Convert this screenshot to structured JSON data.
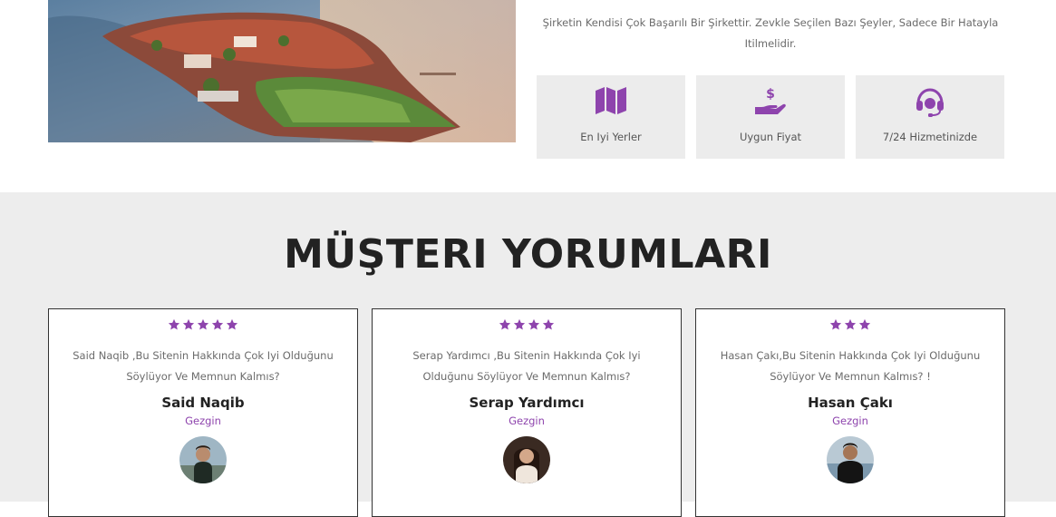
{
  "about": {
    "text": "Şirketin Kendisi Çok Başarılı Bir Şirkettir. Zevkle Seçilen Bazı Şeyler, Sadece Bir Hatayla Itilmelidir."
  },
  "features": [
    {
      "label": "En Iyi Yerler",
      "icon": "map-icon"
    },
    {
      "label": "Uygun Fiyat",
      "icon": "hand-dollar-icon"
    },
    {
      "label": "7/24 Hizmetinizde",
      "icon": "headset-icon"
    }
  ],
  "reviews": {
    "title": "MÜŞTERI YORUMLARI",
    "items": [
      {
        "rating": 5,
        "quote": "Said Naqib ,Bu Sitenin Hakkında Çok Iyi Olduğunu Söylüyor Ve Memnun Kalmıs?",
        "name": "Said Naqib",
        "role": "Gezgin"
      },
      {
        "rating": 4,
        "quote": "Serap Yardımcı ,Bu Sitenin Hakkında Çok Iyi Olduğunu Söylüyor Ve Memnun Kalmıs?",
        "name": "Serap Yardımcı",
        "role": "Gezgin"
      },
      {
        "rating": 3,
        "quote": "Hasan Çakı,Bu Sitenin Hakkında Çok Iyi Olduğunu Söylüyor Ve Memnun Kalmıs? !",
        "name": "Hasan Çakı",
        "role": "Gezgin"
      }
    ]
  },
  "colors": {
    "accent": "#8e44ad",
    "section_bg": "#ededed",
    "feature_bg": "#ececec"
  }
}
